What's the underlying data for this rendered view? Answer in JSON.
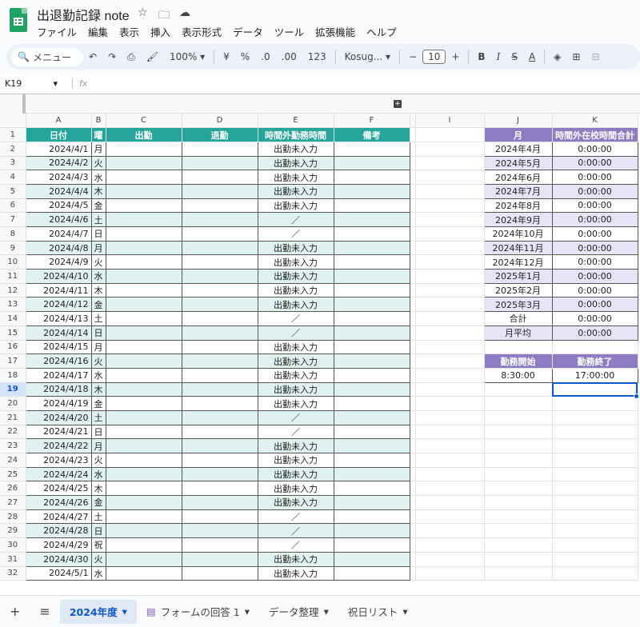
{
  "app": {
    "title": "出退勤記録 note",
    "menu": [
      "ファイル",
      "編集",
      "表示",
      "挿入",
      "表示形式",
      "データ",
      "ツール",
      "拡張機能",
      "ヘルプ"
    ]
  },
  "toolbar": {
    "search": "メニュー",
    "zoom": "100%",
    "currency": "¥",
    "percent": "%",
    "dec_dec": ".0",
    "dec_inc": ".00",
    "numfmt": "123",
    "font": "Kosug...",
    "fontsize": "10"
  },
  "formula": {
    "cell": "K19",
    "fx": "fx"
  },
  "columns": [
    "",
    "A",
    "B",
    "C",
    "D",
    "E",
    "F",
    "",
    "I",
    "J",
    "K"
  ],
  "header_row": {
    "A": "日付",
    "B": "曜",
    "C": "出勤",
    "D": "退勤",
    "E": "時間外勤務時間",
    "F": "備考",
    "J": "月",
    "K": "時間外在校時間合計"
  },
  "rows": [
    {
      "n": "2",
      "date": "2024/4/1",
      "dow": "月",
      "e": "出勤未入力"
    },
    {
      "n": "3",
      "date": "2024/4/2",
      "dow": "火",
      "e": "出勤未入力"
    },
    {
      "n": "4",
      "date": "2024/4/3",
      "dow": "水",
      "e": "出勤未入力"
    },
    {
      "n": "5",
      "date": "2024/4/4",
      "dow": "木",
      "e": "出勤未入力"
    },
    {
      "n": "6",
      "date": "2024/4/5",
      "dow": "金",
      "e": "出勤未入力"
    },
    {
      "n": "7",
      "date": "2024/4/6",
      "dow": "土",
      "e": "／"
    },
    {
      "n": "8",
      "date": "2024/4/7",
      "dow": "日",
      "e": "／"
    },
    {
      "n": "9",
      "date": "2024/4/8",
      "dow": "月",
      "e": "出勤未入力"
    },
    {
      "n": "10",
      "date": "2024/4/9",
      "dow": "火",
      "e": "出勤未入力"
    },
    {
      "n": "11",
      "date": "2024/4/10",
      "dow": "水",
      "e": "出勤未入力"
    },
    {
      "n": "12",
      "date": "2024/4/11",
      "dow": "木",
      "e": "出勤未入力"
    },
    {
      "n": "13",
      "date": "2024/4/12",
      "dow": "金",
      "e": "出勤未入力"
    },
    {
      "n": "14",
      "date": "2024/4/13",
      "dow": "土",
      "e": "／"
    },
    {
      "n": "15",
      "date": "2024/4/14",
      "dow": "日",
      "e": "／"
    },
    {
      "n": "16",
      "date": "2024/4/15",
      "dow": "月",
      "e": "出勤未入力"
    },
    {
      "n": "17",
      "date": "2024/4/16",
      "dow": "火",
      "e": "出勤未入力"
    },
    {
      "n": "18",
      "date": "2024/4/17",
      "dow": "水",
      "e": "出勤未入力"
    },
    {
      "n": "19",
      "date": "2024/4/18",
      "dow": "木",
      "e": "出勤未入力"
    },
    {
      "n": "20",
      "date": "2024/4/19",
      "dow": "金",
      "e": "出勤未入力"
    },
    {
      "n": "21",
      "date": "2024/4/20",
      "dow": "土",
      "e": "／"
    },
    {
      "n": "22",
      "date": "2024/4/21",
      "dow": "日",
      "e": "／"
    },
    {
      "n": "23",
      "date": "2024/4/22",
      "dow": "月",
      "e": "出勤未入力"
    },
    {
      "n": "24",
      "date": "2024/4/23",
      "dow": "火",
      "e": "出勤未入力"
    },
    {
      "n": "25",
      "date": "2024/4/24",
      "dow": "水",
      "e": "出勤未入力"
    },
    {
      "n": "26",
      "date": "2024/4/25",
      "dow": "木",
      "e": "出勤未入力"
    },
    {
      "n": "27",
      "date": "2024/4/26",
      "dow": "金",
      "e": "出勤未入力"
    },
    {
      "n": "28",
      "date": "2024/4/27",
      "dow": "土",
      "e": "／"
    },
    {
      "n": "29",
      "date": "2024/4/28",
      "dow": "日",
      "e": "／"
    },
    {
      "n": "30",
      "date": "2024/4/29",
      "dow": "祝",
      "e": "／"
    },
    {
      "n": "31",
      "date": "2024/4/30",
      "dow": "火",
      "e": "出勤未入力"
    },
    {
      "n": "32",
      "date": "2024/5/1",
      "dow": "水",
      "e": "出勤未入力"
    }
  ],
  "summary": [
    {
      "month": "2024年4月",
      "total": "0:00:00"
    },
    {
      "month": "2024年5月",
      "total": "0:00:00"
    },
    {
      "month": "2024年6月",
      "total": "0:00:00"
    },
    {
      "month": "2024年7月",
      "total": "0:00:00"
    },
    {
      "month": "2024年8月",
      "total": "0:00:00"
    },
    {
      "month": "2024年9月",
      "total": "0:00:00"
    },
    {
      "month": "2024年10月",
      "total": "0:00:00"
    },
    {
      "month": "2024年11月",
      "total": "0:00:00"
    },
    {
      "month": "2024年12月",
      "total": "0:00:00"
    },
    {
      "month": "2025年1月",
      "total": "0:00:00"
    },
    {
      "month": "2025年2月",
      "total": "0:00:00"
    },
    {
      "month": "2025年3月",
      "total": "0:00:00"
    },
    {
      "month": "合計",
      "total": "0:00:00"
    },
    {
      "month": "月平均",
      "total": "0:00:00"
    }
  ],
  "work": {
    "start_label": "勤務開始",
    "end_label": "勤務終了",
    "start": "8:30:00",
    "end": "17:00:00"
  },
  "tabs": [
    "2024年度",
    "フォームの回答 1",
    "データ整理",
    "祝日リスト"
  ],
  "colors": {
    "teal": "#26a69a",
    "band": "#dff2ef",
    "purple": "#8e7cc3",
    "lavender": "#e8e4f7",
    "select": "#0b57d0"
  }
}
